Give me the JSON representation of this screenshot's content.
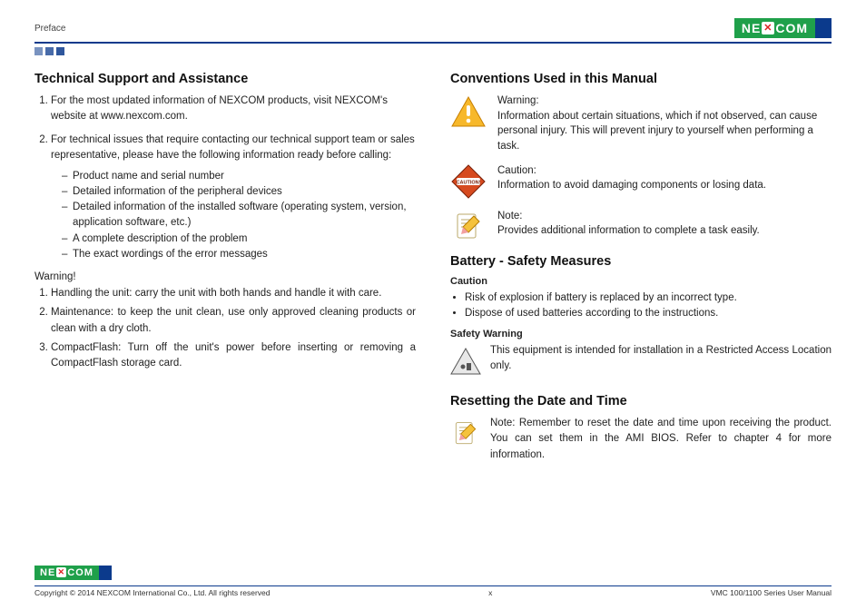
{
  "header": {
    "section": "Preface",
    "logo": "NEXCOM"
  },
  "left": {
    "h_support": "Technical Support and Assistance",
    "support_items": [
      "For the most updated information of NEXCOM products, visit NEXCOM's website at www.nexcom.com.",
      "For technical issues that require contacting our technical support team or sales representative, please have the following information ready before calling:"
    ],
    "checklist": [
      "Product name and serial number",
      "Detailed information of the peripheral devices",
      "Detailed information of the installed software (operating system, version, application software, etc.)",
      "A complete description of the problem",
      "The exact wordings of the error messages"
    ],
    "warn_label": "Warning!",
    "warnings": [
      "Handling the unit: carry the unit with both hands and handle it with care.",
      "Maintenance: to keep the unit clean, use only approved cleaning products or clean with a dry cloth.",
      "CompactFlash: Turn off the unit's power before inserting or removing a CompactFlash storage card."
    ]
  },
  "right": {
    "h_conv": "Conventions Used in this Manual",
    "conv": [
      {
        "title": "Warning:",
        "body": "Information about certain situations, which if not observed, can cause personal injury. This will prevent injury to yourself when performing a task."
      },
      {
        "title": "Caution:",
        "body": "Information to avoid damaging components or losing data."
      },
      {
        "title": "Note:",
        "body": "Provides additional information to complete a task easily."
      }
    ],
    "h_batt": "Battery - Safety Measures",
    "sub_caution": "Caution",
    "caution_items": [
      "Risk of explosion if battery is replaced by an incorrect type.",
      "Dispose of used batteries according to the instructions."
    ],
    "sub_safety": "Safety Warning",
    "safety_body": "This equipment is intended for installation in a Restricted Access Location only.",
    "h_reset": "Resetting the Date and Time",
    "reset_body": "Note: Remember to reset the date and time upon receiving the product. You can set them in the AMI BIOS. Refer to chapter 4 for more information."
  },
  "footer": {
    "copyright": "Copyright © 2014 NEXCOM International Co., Ltd. All rights reserved",
    "page": "x",
    "manual": "VMC 100/1100 Series User Manual"
  }
}
